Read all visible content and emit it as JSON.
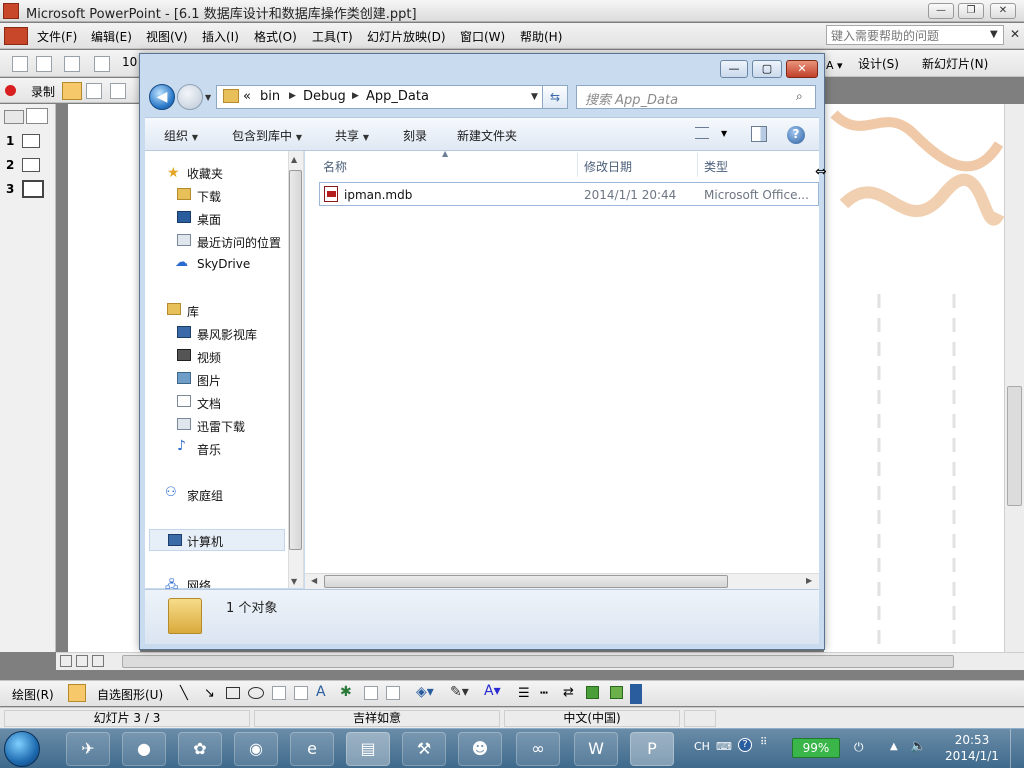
{
  "powerpoint": {
    "title": "Microsoft PowerPoint - [6.1 数据库设计和数据库操作类创建.ppt]",
    "menus": [
      "文件(F)",
      "编辑(E)",
      "视图(V)",
      "插入(I)",
      "格式(O)",
      "工具(T)",
      "幻灯片放映(D)",
      "窗口(W)",
      "帮助(H)"
    ],
    "help_placeholder": "键入需要帮助的问题",
    "font_size_value": "10",
    "design_label": "设计(S)",
    "new_slide_label": "新幻灯片(N)",
    "record_label": "录制",
    "slide_numbers": [
      "1",
      "2",
      "3"
    ],
    "draw_label": "绘图(R)",
    "autoshape_label": "自选图形(U)",
    "status": {
      "slide": "幻灯片 3 / 3",
      "design": "吉祥如意",
      "language": "中文(中国)"
    }
  },
  "explorer": {
    "breadcrumb": [
      "«",
      "bin",
      "Debug",
      "App_Data"
    ],
    "search_placeholder": "搜索 App_Data",
    "commands": {
      "organize": "组织",
      "include_in_library": "包含到库中",
      "share": "共享",
      "burn": "刻录",
      "new_folder": "新建文件夹"
    },
    "nav": {
      "favorites_header": "收藏夹",
      "favorites": [
        "下载",
        "桌面",
        "最近访问的位置",
        "SkyDrive"
      ],
      "libraries_header": "库",
      "libraries": [
        "暴风影视库",
        "视频",
        "图片",
        "文档",
        "迅雷下载",
        "音乐"
      ],
      "homegroup": "家庭组",
      "computer": "计算机",
      "network": "网络"
    },
    "columns": {
      "name": "名称",
      "date": "修改日期",
      "type": "类型"
    },
    "files": [
      {
        "name": "ipman.mdb",
        "date": "2014/1/1 20:44",
        "type": "Microsoft Office..."
      }
    ],
    "item_count": "1 个对象"
  },
  "taskbar": {
    "input_lang": "CH",
    "battery": "99%",
    "time": "20:53",
    "date": "2014/1/1"
  }
}
